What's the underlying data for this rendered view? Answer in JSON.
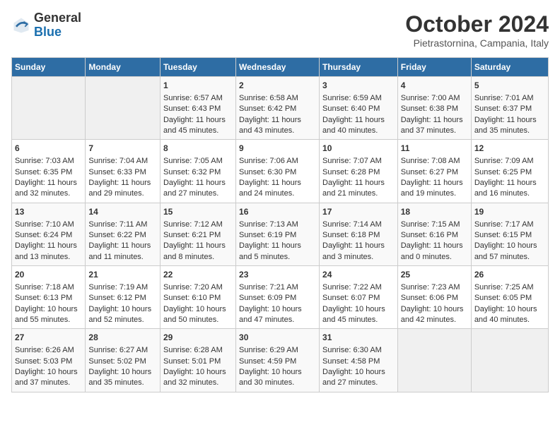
{
  "header": {
    "logo_general": "General",
    "logo_blue": "Blue",
    "title": "October 2024",
    "location": "Pietrastornina, Campania, Italy"
  },
  "days_of_week": [
    "Sunday",
    "Monday",
    "Tuesday",
    "Wednesday",
    "Thursday",
    "Friday",
    "Saturday"
  ],
  "weeks": [
    [
      {
        "day": "",
        "content": ""
      },
      {
        "day": "",
        "content": ""
      },
      {
        "day": "1",
        "content": "Sunrise: 6:57 AM\nSunset: 6:43 PM\nDaylight: 11 hours and 45 minutes."
      },
      {
        "day": "2",
        "content": "Sunrise: 6:58 AM\nSunset: 6:42 PM\nDaylight: 11 hours and 43 minutes."
      },
      {
        "day": "3",
        "content": "Sunrise: 6:59 AM\nSunset: 6:40 PM\nDaylight: 11 hours and 40 minutes."
      },
      {
        "day": "4",
        "content": "Sunrise: 7:00 AM\nSunset: 6:38 PM\nDaylight: 11 hours and 37 minutes."
      },
      {
        "day": "5",
        "content": "Sunrise: 7:01 AM\nSunset: 6:37 PM\nDaylight: 11 hours and 35 minutes."
      }
    ],
    [
      {
        "day": "6",
        "content": "Sunrise: 7:03 AM\nSunset: 6:35 PM\nDaylight: 11 hours and 32 minutes."
      },
      {
        "day": "7",
        "content": "Sunrise: 7:04 AM\nSunset: 6:33 PM\nDaylight: 11 hours and 29 minutes."
      },
      {
        "day": "8",
        "content": "Sunrise: 7:05 AM\nSunset: 6:32 PM\nDaylight: 11 hours and 27 minutes."
      },
      {
        "day": "9",
        "content": "Sunrise: 7:06 AM\nSunset: 6:30 PM\nDaylight: 11 hours and 24 minutes."
      },
      {
        "day": "10",
        "content": "Sunrise: 7:07 AM\nSunset: 6:28 PM\nDaylight: 11 hours and 21 minutes."
      },
      {
        "day": "11",
        "content": "Sunrise: 7:08 AM\nSunset: 6:27 PM\nDaylight: 11 hours and 19 minutes."
      },
      {
        "day": "12",
        "content": "Sunrise: 7:09 AM\nSunset: 6:25 PM\nDaylight: 11 hours and 16 minutes."
      }
    ],
    [
      {
        "day": "13",
        "content": "Sunrise: 7:10 AM\nSunset: 6:24 PM\nDaylight: 11 hours and 13 minutes."
      },
      {
        "day": "14",
        "content": "Sunrise: 7:11 AM\nSunset: 6:22 PM\nDaylight: 11 hours and 11 minutes."
      },
      {
        "day": "15",
        "content": "Sunrise: 7:12 AM\nSunset: 6:21 PM\nDaylight: 11 hours and 8 minutes."
      },
      {
        "day": "16",
        "content": "Sunrise: 7:13 AM\nSunset: 6:19 PM\nDaylight: 11 hours and 5 minutes."
      },
      {
        "day": "17",
        "content": "Sunrise: 7:14 AM\nSunset: 6:18 PM\nDaylight: 11 hours and 3 minutes."
      },
      {
        "day": "18",
        "content": "Sunrise: 7:15 AM\nSunset: 6:16 PM\nDaylight: 11 hours and 0 minutes."
      },
      {
        "day": "19",
        "content": "Sunrise: 7:17 AM\nSunset: 6:15 PM\nDaylight: 10 hours and 57 minutes."
      }
    ],
    [
      {
        "day": "20",
        "content": "Sunrise: 7:18 AM\nSunset: 6:13 PM\nDaylight: 10 hours and 55 minutes."
      },
      {
        "day": "21",
        "content": "Sunrise: 7:19 AM\nSunset: 6:12 PM\nDaylight: 10 hours and 52 minutes."
      },
      {
        "day": "22",
        "content": "Sunrise: 7:20 AM\nSunset: 6:10 PM\nDaylight: 10 hours and 50 minutes."
      },
      {
        "day": "23",
        "content": "Sunrise: 7:21 AM\nSunset: 6:09 PM\nDaylight: 10 hours and 47 minutes."
      },
      {
        "day": "24",
        "content": "Sunrise: 7:22 AM\nSunset: 6:07 PM\nDaylight: 10 hours and 45 minutes."
      },
      {
        "day": "25",
        "content": "Sunrise: 7:23 AM\nSunset: 6:06 PM\nDaylight: 10 hours and 42 minutes."
      },
      {
        "day": "26",
        "content": "Sunrise: 7:25 AM\nSunset: 6:05 PM\nDaylight: 10 hours and 40 minutes."
      }
    ],
    [
      {
        "day": "27",
        "content": "Sunrise: 6:26 AM\nSunset: 5:03 PM\nDaylight: 10 hours and 37 minutes."
      },
      {
        "day": "28",
        "content": "Sunrise: 6:27 AM\nSunset: 5:02 PM\nDaylight: 10 hours and 35 minutes."
      },
      {
        "day": "29",
        "content": "Sunrise: 6:28 AM\nSunset: 5:01 PM\nDaylight: 10 hours and 32 minutes."
      },
      {
        "day": "30",
        "content": "Sunrise: 6:29 AM\nSunset: 4:59 PM\nDaylight: 10 hours and 30 minutes."
      },
      {
        "day": "31",
        "content": "Sunrise: 6:30 AM\nSunset: 4:58 PM\nDaylight: 10 hours and 27 minutes."
      },
      {
        "day": "",
        "content": ""
      },
      {
        "day": "",
        "content": ""
      }
    ]
  ]
}
